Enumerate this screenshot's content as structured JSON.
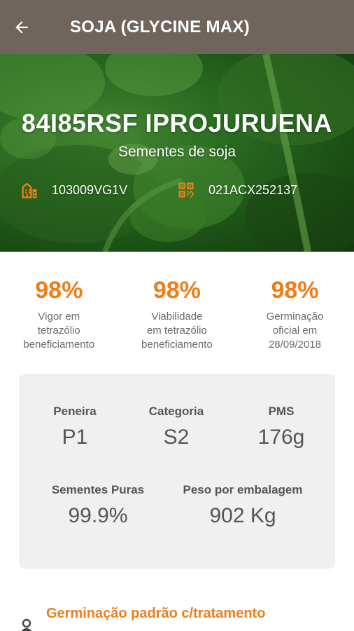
{
  "appbar": {
    "title": "SOJA (GLYCINE MAX)"
  },
  "hero": {
    "title": "84I85RSF IPROJURUENA",
    "subtitle": "Sementes de soja",
    "code_left": "103009VG1V",
    "code_right": "021ACX252137"
  },
  "stats": [
    {
      "value": "98%",
      "label_lines": [
        "Vigor em",
        "tetrazólio",
        "beneficiamento"
      ]
    },
    {
      "value": "98%",
      "label_lines": [
        "Viabilidade",
        "em tetrazólio",
        "beneficiamento"
      ]
    },
    {
      "value": "98%",
      "label_lines": [
        "Germinação",
        "oficial em",
        "28/09/2018"
      ]
    }
  ],
  "details": {
    "peneira": {
      "label": "Peneira",
      "value": "P1"
    },
    "categoria": {
      "label": "Categoria",
      "value": "S2"
    },
    "pms": {
      "label": "PMS",
      "value": "176g"
    },
    "sementes_puras": {
      "label": "Sementes Puras",
      "value": "99.9%"
    },
    "peso": {
      "label": "Peso por embalagem",
      "value": "902 Kg"
    }
  },
  "section": {
    "title": "Germinação padrão c/tratamento"
  },
  "colors": {
    "accent": "#ef7d1a",
    "appbar": "#6f655d",
    "card": "#f0f0f0"
  },
  "icons": {
    "back": "arrow-left-icon",
    "building": "building-icon",
    "qr": "qr-code-icon",
    "section": "person-pin-icon"
  }
}
